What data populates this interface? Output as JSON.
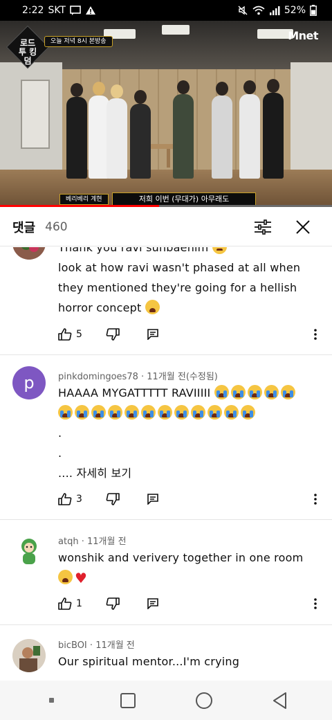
{
  "status_bar": {
    "time": "2:22",
    "carrier": "SKT",
    "battery": "52%"
  },
  "video": {
    "program_logo": "로드 투 킹덤",
    "banner": "오늘 저녁 8시 본방송",
    "channel_logo": "Mnet",
    "caption_name": "베리베리 계현",
    "caption_text": "저희 이번 (무대가) 아무래도",
    "progress_percent": 48
  },
  "comments_header": {
    "title": "댓글",
    "count": "460",
    "filter_icon": "sliders-icon",
    "close_icon": "close-icon"
  },
  "comments": [
    {
      "author": "",
      "time": "",
      "lines": [
        "Thank you ravi sunbaenim",
        "look at how ravi wasn't phased at all when",
        "they mentioned they're going for a hellish",
        "horror concept"
      ],
      "likes": "5"
    },
    {
      "author": "pinkdomingoes78",
      "time": "11개월 전(수정됨)",
      "lines": [
        "HAAAA MYGATTTTT RAVIIIII",
        "",
        ".",
        ".",
        "...."
      ],
      "read_more": "자세히 보기",
      "likes": "3"
    },
    {
      "author": "atqh",
      "time": "11개월 전",
      "lines": [
        "wonshik and verivery together in one room"
      ],
      "likes": "1"
    },
    {
      "author": "bicBOI",
      "time": "11개월 전",
      "lines": [
        "Our spiritual mentor...I'm crying"
      ]
    }
  ],
  "avatar_letter": "p",
  "colors": {
    "avatar_purple": "#7e57c2",
    "progress_red": "#ff0000",
    "text_primary": "#0f0f0f",
    "text_secondary": "#606060"
  }
}
